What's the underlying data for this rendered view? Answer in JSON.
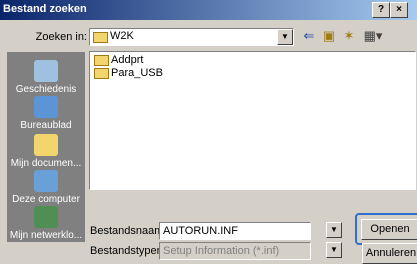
{
  "window": {
    "title": "Bestand zoeken",
    "help_label": "?",
    "close_label": "×"
  },
  "lookin": {
    "label": "Zoeken in:",
    "value": "W2K"
  },
  "toolbar": {
    "back_icon": "back-arrow-icon",
    "up_icon": "up-folder-icon",
    "new_icon": "new-folder-icon",
    "view_icon": "view-menu-icon"
  },
  "places": [
    {
      "label": "Geschiedenis",
      "icon": "history-icon"
    },
    {
      "label": "Bureaublad",
      "icon": "desktop-icon"
    },
    {
      "label": "Mijn documen...",
      "icon": "my-documents-icon"
    },
    {
      "label": "Deze computer",
      "icon": "my-computer-icon"
    },
    {
      "label": "Mijn netwerklo...",
      "icon": "network-places-icon"
    }
  ],
  "files": [
    {
      "name": "Addprt"
    },
    {
      "name": "Para_USB"
    }
  ],
  "filename": {
    "label": "Bestandsnaam:",
    "value": "AUTORUN.INF"
  },
  "filetype": {
    "label": "Bestandstypen:",
    "value": "Setup Information (*.inf)"
  },
  "buttons": {
    "open": "Openen",
    "cancel": "Annuleren"
  },
  "colors": {
    "title_start": "#0a246a",
    "title_end": "#a6caf0",
    "face": "#d4d0c8",
    "places_bg": "#808080",
    "highlight": "#2f6fd0"
  }
}
